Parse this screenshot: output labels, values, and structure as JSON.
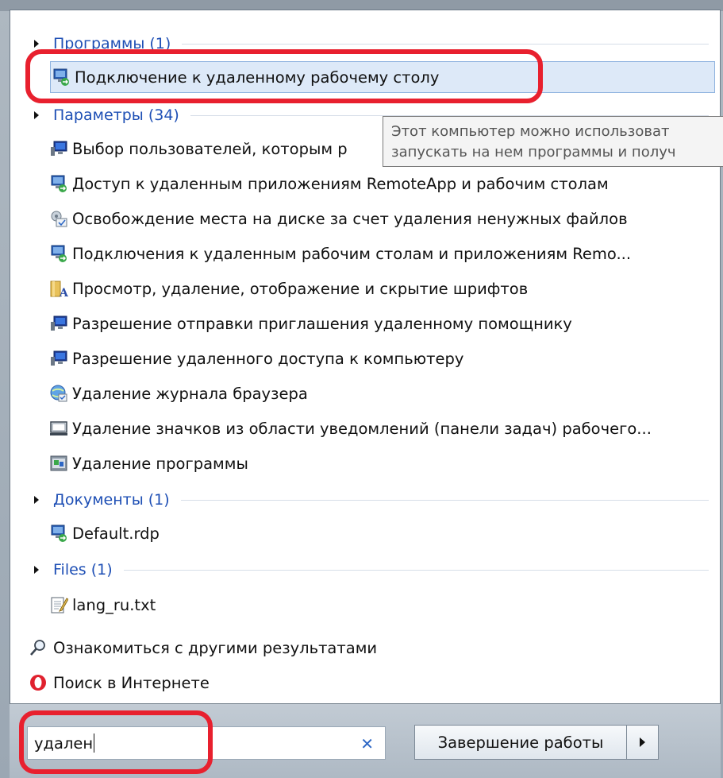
{
  "groups": {
    "programs": "Программы (1)",
    "settings": "Параметры (34)",
    "documents": "Документы (1)",
    "files": "Files (1)"
  },
  "programs": [
    {
      "label": "Подключение к удаленному рабочему столу",
      "icon": "remote-desktop-icon"
    }
  ],
  "settings": [
    {
      "label": "Выбор пользователей, которым р",
      "icon": "monitor-users-icon"
    },
    {
      "label": "Доступ к удаленным приложениям RemoteApp и рабочим столам",
      "icon": "remote-desktop-icon"
    },
    {
      "label": "Освобождение места на диске за счет удаления ненужных файлов",
      "icon": "disk-cleanup-icon"
    },
    {
      "label": "Подключения к удаленным рабочим столам и приложениям Remo...",
      "icon": "remote-desktop-icon"
    },
    {
      "label": "Просмотр, удаление, отображение и скрытие шрифтов",
      "icon": "fonts-folder-icon"
    },
    {
      "label": "Разрешение отправки приглашения удаленному помощнику",
      "icon": "monitor-users-icon"
    },
    {
      "label": "Разрешение удаленного доступа к компьютеру",
      "icon": "monitor-users-icon"
    },
    {
      "label": "Удаление журнала браузера",
      "icon": "internet-options-icon"
    },
    {
      "label": "Удаление значков из области уведомлений (панели задач) рабочего...",
      "icon": "notification-area-icon"
    },
    {
      "label": "Удаление программы",
      "icon": "programs-features-icon"
    }
  ],
  "documents": [
    {
      "label": "Default.rdp",
      "icon": "rdp-file-icon"
    }
  ],
  "files": [
    {
      "label": "lang_ru.txt",
      "icon": "text-file-icon"
    }
  ],
  "links": {
    "more_results": "Ознакомиться с другими результатами",
    "web_search": "Поиск в Интернете"
  },
  "tooltip": {
    "line1": "Этот компьютер можно использоват",
    "line2": "запускать на нем программы и получ"
  },
  "search": {
    "value": "удален",
    "clear_icon": "close-icon"
  },
  "shutdown": {
    "label": "Завершение работы"
  },
  "colors": {
    "link_blue": "#1e4fb5",
    "selection": "#dde9f8",
    "highlight_red": "#e8202e"
  }
}
